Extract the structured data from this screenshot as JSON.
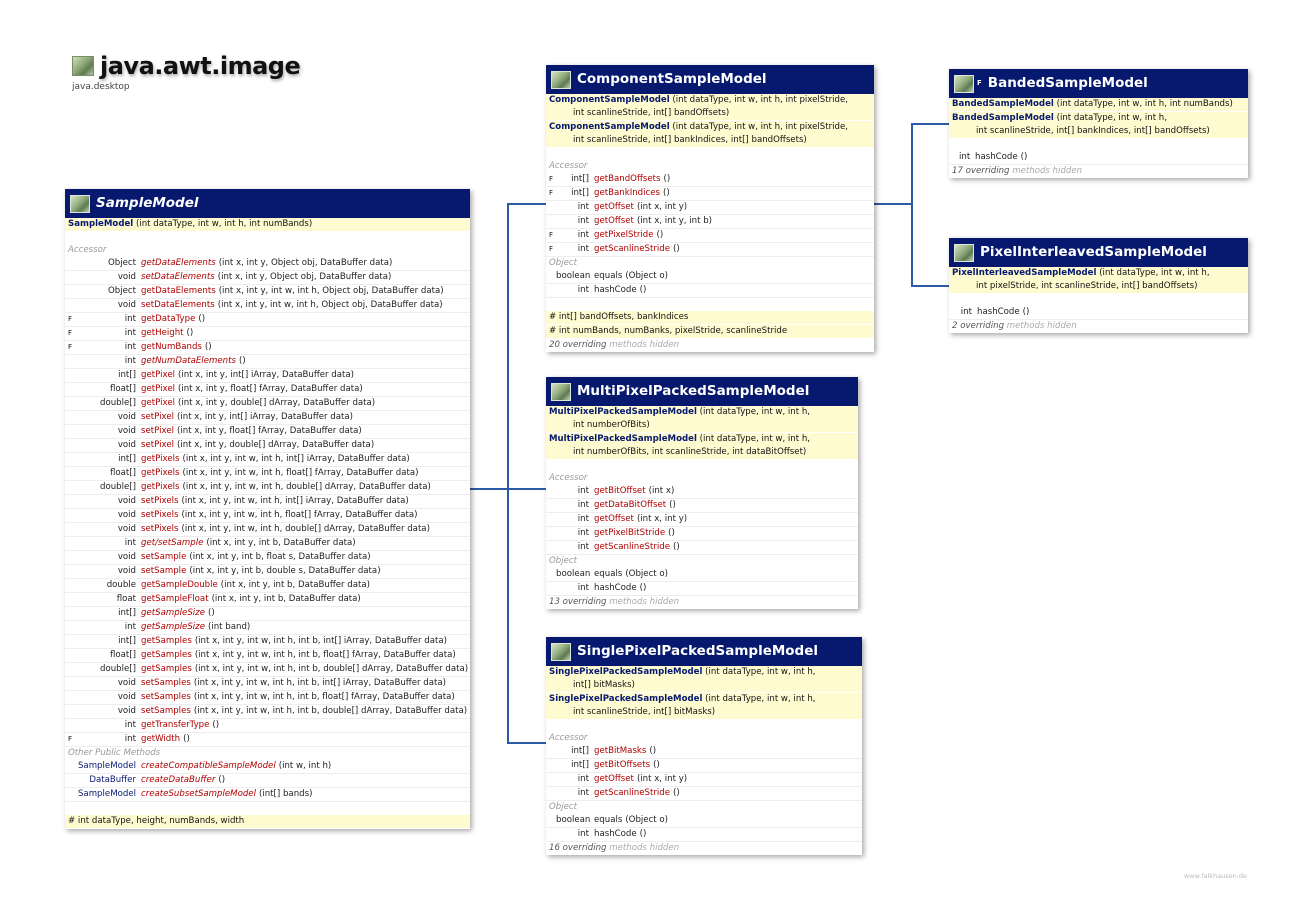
{
  "package": {
    "title": "java.awt.image",
    "module": "java.desktop"
  },
  "watermark": "www.falkhausen.de",
  "classes": {
    "sample": {
      "name": "SampleModel",
      "ctors": [
        [
          "SampleModel",
          " (int dataType, int w, int h, int numBands)",
          ""
        ]
      ],
      "accessor": "Accessor",
      "methods": [
        {
          "f": "",
          "t": "Object",
          "n": "getDataElements",
          "a": "(int x, int y, Object obj, DataBuffer data)",
          "ab": true
        },
        {
          "f": "",
          "t": "void",
          "n": "setDataElements",
          "a": "(int x, int y, Object obj, DataBuffer data)",
          "ab": true
        },
        {
          "f": "",
          "t": "Object",
          "n": "getDataElements",
          "a": "(int x, int y, int w, int h, Object obj, DataBuffer data)"
        },
        {
          "f": "",
          "t": "void",
          "n": "setDataElements",
          "a": "(int x, int y, int w, int h, Object obj, DataBuffer data)"
        },
        {
          "f": "F",
          "t": "int",
          "n": "getDataType",
          "a": "()"
        },
        {
          "f": "F",
          "t": "int",
          "n": "getHeight",
          "a": "()"
        },
        {
          "f": "F",
          "t": "int",
          "n": "getNumBands",
          "a": "()"
        },
        {
          "f": "",
          "t": "int",
          "n": "getNumDataElements",
          "a": "()",
          "ab": true
        },
        {
          "f": "",
          "t": "int[]",
          "n": "getPixel",
          "a": "(int x, int y, int[] iArray, DataBuffer data)"
        },
        {
          "f": "",
          "t": "float[]",
          "n": "getPixel",
          "a": "(int x, int y, float[] fArray, DataBuffer data)"
        },
        {
          "f": "",
          "t": "double[]",
          "n": "getPixel",
          "a": "(int x, int y, double[] dArray, DataBuffer data)"
        },
        {
          "f": "",
          "t": "void",
          "n": "setPixel",
          "a": "(int x, int y, int[] iArray, DataBuffer data)"
        },
        {
          "f": "",
          "t": "void",
          "n": "setPixel",
          "a": "(int x, int y, float[] fArray, DataBuffer data)"
        },
        {
          "f": "",
          "t": "void",
          "n": "setPixel",
          "a": "(int x, int y, double[] dArray, DataBuffer data)"
        },
        {
          "f": "",
          "t": "int[]",
          "n": "getPixels",
          "a": "(int x, int y, int w, int h, int[] iArray, DataBuffer data)"
        },
        {
          "f": "",
          "t": "float[]",
          "n": "getPixels",
          "a": "(int x, int y, int w, int h, float[] fArray, DataBuffer data)"
        },
        {
          "f": "",
          "t": "double[]",
          "n": "getPixels",
          "a": "(int x, int y, int w, int h, double[] dArray, DataBuffer data)"
        },
        {
          "f": "",
          "t": "void",
          "n": "setPixels",
          "a": "(int x, int y, int w, int h, int[] iArray, DataBuffer data)"
        },
        {
          "f": "",
          "t": "void",
          "n": "setPixels",
          "a": "(int x, int y, int w, int h, float[] fArray, DataBuffer data)"
        },
        {
          "f": "",
          "t": "void",
          "n": "setPixels",
          "a": "(int x, int y, int w, int h, double[] dArray, DataBuffer data)"
        },
        {
          "f": "",
          "t": "int",
          "n": "get/setSample",
          "a": "(int x, int y, int b, DataBuffer data)",
          "ab": true
        },
        {
          "f": "",
          "t": "void",
          "n": "setSample",
          "a": "(int x, int y, int b, float s, DataBuffer data)"
        },
        {
          "f": "",
          "t": "void",
          "n": "setSample",
          "a": "(int x, int y, int b, double s, DataBuffer data)"
        },
        {
          "f": "",
          "t": "double",
          "n": "getSampleDouble",
          "a": "(int x, int y, int b, DataBuffer data)"
        },
        {
          "f": "",
          "t": "float",
          "n": "getSampleFloat",
          "a": "(int x, int y, int b, DataBuffer data)"
        },
        {
          "f": "",
          "t": "int[]",
          "n": "getSampleSize",
          "a": "()",
          "ab": true
        },
        {
          "f": "",
          "t": "int",
          "n": "getSampleSize",
          "a": "(int band)",
          "ab": true
        },
        {
          "f": "",
          "t": "int[]",
          "n": "getSamples",
          "a": "(int x, int y, int w, int h, int b, int[] iArray, DataBuffer data)"
        },
        {
          "f": "",
          "t": "float[]",
          "n": "getSamples",
          "a": "(int x, int y, int w, int h, int b, float[] fArray, DataBuffer data)"
        },
        {
          "f": "",
          "t": "double[]",
          "n": "getSamples",
          "a": "(int x, int y, int w, int h, int b, double[] dArray, DataBuffer data)"
        },
        {
          "f": "",
          "t": "void",
          "n": "setSamples",
          "a": "(int x, int y, int w, int h, int b, int[] iArray, DataBuffer data)"
        },
        {
          "f": "",
          "t": "void",
          "n": "setSamples",
          "a": "(int x, int y, int w, int h, int b, float[] fArray, DataBuffer data)"
        },
        {
          "f": "",
          "t": "void",
          "n": "setSamples",
          "a": "(int x, int y, int w, int h, int b, double[] dArray, DataBuffer data)"
        },
        {
          "f": "",
          "t": "int",
          "n": "getTransferType",
          "a": "()"
        },
        {
          "f": "F",
          "t": "int",
          "n": "getWidth",
          "a": "()"
        }
      ],
      "other": "Other Public Methods",
      "otherMethods": [
        {
          "f": "",
          "t": "SampleModel",
          "n": "createCompatibleSampleModel",
          "a": "(int w, int h)",
          "ab": true,
          "cls": true
        },
        {
          "f": "",
          "t": "DataBuffer",
          "n": "createDataBuffer",
          "a": "()",
          "ab": true,
          "cls": true
        },
        {
          "f": "",
          "t": "SampleModel",
          "n": "createSubsetSampleModel",
          "a": "(int[] bands)",
          "ab": true,
          "cls": true
        }
      ],
      "fields": [
        "# int dataType, height, numBands, width"
      ]
    },
    "component": {
      "name": "ComponentSampleModel",
      "ctors": [
        [
          "ComponentSampleModel",
          " (int dataType, int w, int h, int pixelStride,",
          "int scanlineStride, int[] bandOffsets)"
        ],
        [
          "ComponentSampleModel",
          " (int dataType, int w, int h, int pixelStride,",
          "int scanlineStride, int[] bankIndices, int[] bandOffsets)"
        ]
      ],
      "accessor": "Accessor",
      "methods": [
        {
          "f": "F",
          "t": "int[]",
          "n": "getBandOffsets",
          "a": "()"
        },
        {
          "f": "F",
          "t": "int[]",
          "n": "getBankIndices",
          "a": "()"
        },
        {
          "f": "",
          "t": "int",
          "n": "getOffset",
          "a": "(int x, int y)"
        },
        {
          "f": "",
          "t": "int",
          "n": "getOffset",
          "a": "(int x, int y, int b)"
        },
        {
          "f": "F",
          "t": "int",
          "n": "getPixelStride",
          "a": "()"
        },
        {
          "f": "F",
          "t": "int",
          "n": "getScanlineStride",
          "a": "()"
        }
      ],
      "object": "Object",
      "objMethods": [
        {
          "f": "",
          "t": "boolean",
          "n": "equals",
          "a": "(Object o)",
          "plain": true
        },
        {
          "f": "",
          "t": "int",
          "n": "hashCode",
          "a": "()",
          "plain": true
        }
      ],
      "fields": [
        "# int[]  bandOffsets, bankIndices",
        "# int numBands, numBanks, pixelStride, scanlineStride"
      ],
      "overriding": "20 overriding",
      "hidden": "methods hidden"
    },
    "banded": {
      "name": "BandedSampleModel",
      "ctors": [
        [
          "BandedSampleModel",
          " (int dataType, int w, int h, int numBands)",
          ""
        ],
        [
          "BandedSampleModel",
          " (int dataType, int w, int h,",
          "int scanlineStride, int[] bankIndices, int[] bandOffsets)"
        ]
      ],
      "objMethods": [
        {
          "f": "",
          "t": "int",
          "n": "hashCode",
          "a": "()",
          "plain": true
        }
      ],
      "overriding": "17 overriding",
      "hidden": "methods hidden"
    },
    "pixel": {
      "name": "PixelInterleavedSampleModel",
      "ctors": [
        [
          "PixelInterleavedSampleModel",
          " (int dataType, int w, int h,",
          "int pixelStride, int scanlineStride, int[] bandOffsets)"
        ]
      ],
      "objMethods": [
        {
          "f": "",
          "t": "int",
          "n": "hashCode",
          "a": "()",
          "plain": true
        }
      ],
      "overriding": "2 overriding",
      "hidden": "methods hidden"
    },
    "multi": {
      "name": "MultiPixelPackedSampleModel",
      "ctors": [
        [
          "MultiPixelPackedSampleModel",
          " (int dataType, int w, int h,",
          "int numberOfBits)"
        ],
        [
          "MultiPixelPackedSampleModel",
          " (int dataType, int w, int h,",
          "int numberOfBits, int scanlineStride, int dataBitOffset)"
        ]
      ],
      "accessor": "Accessor",
      "methods": [
        {
          "f": "",
          "t": "int",
          "n": "getBitOffset",
          "a": "(int x)"
        },
        {
          "f": "",
          "t": "int",
          "n": "getDataBitOffset",
          "a": "()"
        },
        {
          "f": "",
          "t": "int",
          "n": "getOffset",
          "a": "(int x, int y)"
        },
        {
          "f": "",
          "t": "int",
          "n": "getPixelBitStride",
          "a": "()"
        },
        {
          "f": "",
          "t": "int",
          "n": "getScanlineStride",
          "a": "()"
        }
      ],
      "object": "Object",
      "objMethods": [
        {
          "f": "",
          "t": "boolean",
          "n": "equals",
          "a": "(Object o)",
          "plain": true
        },
        {
          "f": "",
          "t": "int",
          "n": "hashCode",
          "a": "()",
          "plain": true
        }
      ],
      "overriding": "13 overriding",
      "hidden": "methods hidden"
    },
    "single": {
      "name": "SinglePixelPackedSampleModel",
      "ctors": [
        [
          "SinglePixelPackedSampleModel",
          " (int dataType, int w, int h,",
          "int[] bitMasks)"
        ],
        [
          "SinglePixelPackedSampleModel",
          " (int dataType, int w, int h,",
          "int scanlineStride, int[] bitMasks)"
        ]
      ],
      "accessor": "Accessor",
      "methods": [
        {
          "f": "",
          "t": "int[]",
          "n": "getBitMasks",
          "a": "()"
        },
        {
          "f": "",
          "t": "int[]",
          "n": "getBitOffsets",
          "a": "()"
        },
        {
          "f": "",
          "t": "int",
          "n": "getOffset",
          "a": "(int x, int y)"
        },
        {
          "f": "",
          "t": "int",
          "n": "getScanlineStride",
          "a": "()"
        }
      ],
      "object": "Object",
      "objMethods": [
        {
          "f": "",
          "t": "boolean",
          "n": "equals",
          "a": "(Object o)",
          "plain": true
        },
        {
          "f": "",
          "t": "int",
          "n": "hashCode",
          "a": "()",
          "plain": true
        }
      ],
      "overriding": "16 overriding",
      "hidden": "methods hidden"
    }
  }
}
